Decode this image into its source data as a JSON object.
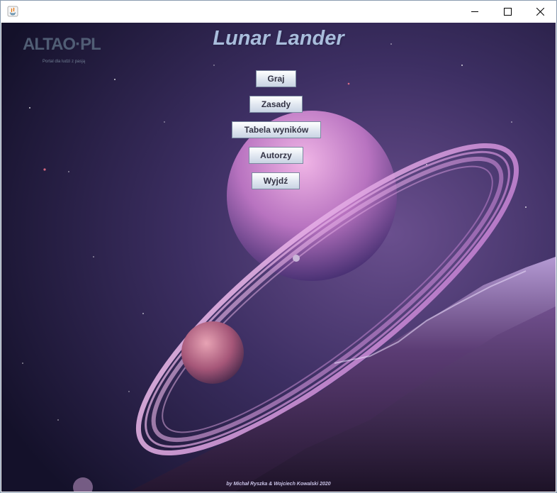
{
  "window": {
    "title": "",
    "controls": {
      "minimize": "minimize-icon",
      "maximize": "maximize-icon",
      "close": "close-icon"
    },
    "app_icon": "java-icon"
  },
  "logo": {
    "text": "ALTAO·PL",
    "tagline": "Portal dla ludzi z pasją"
  },
  "game": {
    "title": "Lunar Lander"
  },
  "menu": {
    "play": "Graj",
    "rules": "Zasady",
    "scores": "Tabela wyników",
    "authors": "Autorzy",
    "exit": "Wyjdź"
  },
  "footer": {
    "credits": "by Michał Ryszka & Wojciech Kowalski 2020"
  },
  "colors": {
    "title": "#a9bddc",
    "sky_top": "#1c1730",
    "planet": "#d58fd0",
    "mountain": "#3a2448"
  }
}
